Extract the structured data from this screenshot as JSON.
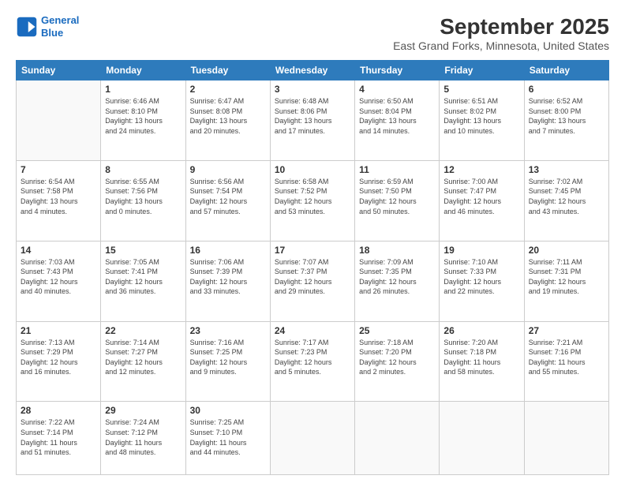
{
  "header": {
    "logo": {
      "line1": "General",
      "line2": "Blue"
    },
    "title": "September 2025",
    "location": "East Grand Forks, Minnesota, United States"
  },
  "weekdays": [
    "Sunday",
    "Monday",
    "Tuesday",
    "Wednesday",
    "Thursday",
    "Friday",
    "Saturday"
  ],
  "weeks": [
    [
      {
        "day": "",
        "info": ""
      },
      {
        "day": "1",
        "info": "Sunrise: 6:46 AM\nSunset: 8:10 PM\nDaylight: 13 hours\nand 24 minutes."
      },
      {
        "day": "2",
        "info": "Sunrise: 6:47 AM\nSunset: 8:08 PM\nDaylight: 13 hours\nand 20 minutes."
      },
      {
        "day": "3",
        "info": "Sunrise: 6:48 AM\nSunset: 8:06 PM\nDaylight: 13 hours\nand 17 minutes."
      },
      {
        "day": "4",
        "info": "Sunrise: 6:50 AM\nSunset: 8:04 PM\nDaylight: 13 hours\nand 14 minutes."
      },
      {
        "day": "5",
        "info": "Sunrise: 6:51 AM\nSunset: 8:02 PM\nDaylight: 13 hours\nand 10 minutes."
      },
      {
        "day": "6",
        "info": "Sunrise: 6:52 AM\nSunset: 8:00 PM\nDaylight: 13 hours\nand 7 minutes."
      }
    ],
    [
      {
        "day": "7",
        "info": "Sunrise: 6:54 AM\nSunset: 7:58 PM\nDaylight: 13 hours\nand 4 minutes."
      },
      {
        "day": "8",
        "info": "Sunrise: 6:55 AM\nSunset: 7:56 PM\nDaylight: 13 hours\nand 0 minutes."
      },
      {
        "day": "9",
        "info": "Sunrise: 6:56 AM\nSunset: 7:54 PM\nDaylight: 12 hours\nand 57 minutes."
      },
      {
        "day": "10",
        "info": "Sunrise: 6:58 AM\nSunset: 7:52 PM\nDaylight: 12 hours\nand 53 minutes."
      },
      {
        "day": "11",
        "info": "Sunrise: 6:59 AM\nSunset: 7:50 PM\nDaylight: 12 hours\nand 50 minutes."
      },
      {
        "day": "12",
        "info": "Sunrise: 7:00 AM\nSunset: 7:47 PM\nDaylight: 12 hours\nand 46 minutes."
      },
      {
        "day": "13",
        "info": "Sunrise: 7:02 AM\nSunset: 7:45 PM\nDaylight: 12 hours\nand 43 minutes."
      }
    ],
    [
      {
        "day": "14",
        "info": "Sunrise: 7:03 AM\nSunset: 7:43 PM\nDaylight: 12 hours\nand 40 minutes."
      },
      {
        "day": "15",
        "info": "Sunrise: 7:05 AM\nSunset: 7:41 PM\nDaylight: 12 hours\nand 36 minutes."
      },
      {
        "day": "16",
        "info": "Sunrise: 7:06 AM\nSunset: 7:39 PM\nDaylight: 12 hours\nand 33 minutes."
      },
      {
        "day": "17",
        "info": "Sunrise: 7:07 AM\nSunset: 7:37 PM\nDaylight: 12 hours\nand 29 minutes."
      },
      {
        "day": "18",
        "info": "Sunrise: 7:09 AM\nSunset: 7:35 PM\nDaylight: 12 hours\nand 26 minutes."
      },
      {
        "day": "19",
        "info": "Sunrise: 7:10 AM\nSunset: 7:33 PM\nDaylight: 12 hours\nand 22 minutes."
      },
      {
        "day": "20",
        "info": "Sunrise: 7:11 AM\nSunset: 7:31 PM\nDaylight: 12 hours\nand 19 minutes."
      }
    ],
    [
      {
        "day": "21",
        "info": "Sunrise: 7:13 AM\nSunset: 7:29 PM\nDaylight: 12 hours\nand 16 minutes."
      },
      {
        "day": "22",
        "info": "Sunrise: 7:14 AM\nSunset: 7:27 PM\nDaylight: 12 hours\nand 12 minutes."
      },
      {
        "day": "23",
        "info": "Sunrise: 7:16 AM\nSunset: 7:25 PM\nDaylight: 12 hours\nand 9 minutes."
      },
      {
        "day": "24",
        "info": "Sunrise: 7:17 AM\nSunset: 7:23 PM\nDaylight: 12 hours\nand 5 minutes."
      },
      {
        "day": "25",
        "info": "Sunrise: 7:18 AM\nSunset: 7:20 PM\nDaylight: 12 hours\nand 2 minutes."
      },
      {
        "day": "26",
        "info": "Sunrise: 7:20 AM\nSunset: 7:18 PM\nDaylight: 11 hours\nand 58 minutes."
      },
      {
        "day": "27",
        "info": "Sunrise: 7:21 AM\nSunset: 7:16 PM\nDaylight: 11 hours\nand 55 minutes."
      }
    ],
    [
      {
        "day": "28",
        "info": "Sunrise: 7:22 AM\nSunset: 7:14 PM\nDaylight: 11 hours\nand 51 minutes."
      },
      {
        "day": "29",
        "info": "Sunrise: 7:24 AM\nSunset: 7:12 PM\nDaylight: 11 hours\nand 48 minutes."
      },
      {
        "day": "30",
        "info": "Sunrise: 7:25 AM\nSunset: 7:10 PM\nDaylight: 11 hours\nand 44 minutes."
      },
      {
        "day": "",
        "info": ""
      },
      {
        "day": "",
        "info": ""
      },
      {
        "day": "",
        "info": ""
      },
      {
        "day": "",
        "info": ""
      }
    ]
  ]
}
